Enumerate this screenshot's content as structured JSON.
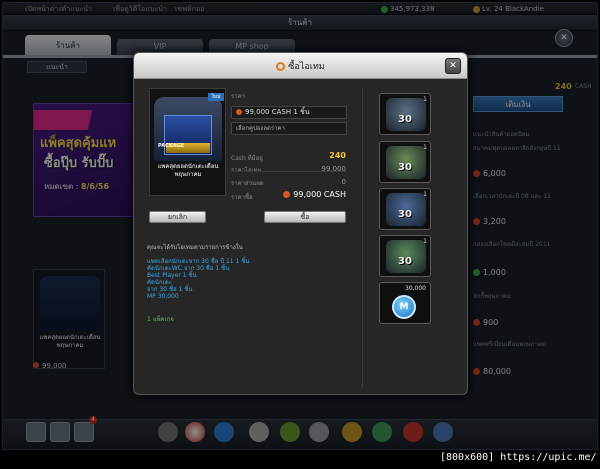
{
  "top_status": {
    "left_text": "เปิดหน้าต่างคำแนะนำ",
    "mid_text": "เพื่อดูวิดีโอแนะนำ",
    "right_text": "เซฟคิกออ",
    "gp_amount": "345,973,338",
    "level_text": "Lv. 24 BlackAndie"
  },
  "header": {
    "shop_title": "ร้านค้า",
    "close_glyph": "✕"
  },
  "tabs": [
    {
      "label": "ร้านค้า"
    },
    {
      "label": "VIP"
    },
    {
      "label": "MP shop"
    }
  ],
  "subtab": {
    "label": "แนะนำ"
  },
  "promo": {
    "line1": "แพ็คสุดคุ้มแห",
    "line2": "ซื้อปุ๊บ รับปั๊บ",
    "date_label": "หมดเขต :",
    "date_value": "8/6/56"
  },
  "bg_card": {
    "name": "แพคสุดยอดนักเตะเดือนพฤษภาคม",
    "price": "99,000"
  },
  "sidebar": {
    "cash_amount": "240",
    "cash_label": "CASH",
    "topup_label": "เติมเงิน",
    "items": [
      {
        "label": "แนะนำสินค้ายอดนิยม",
        "price": ""
      },
      {
        "label": "สมาคมฟุตบอลคลาสิกอังกฤษปี 11",
        "price": "6,000"
      },
      {
        "label": "เลือกเวลานักเตะปี 08 และ 11",
        "price": "3,200"
      },
      {
        "label": "กล่องเลือกโชคดีสะสมปี 2011",
        "price": "1,000"
      },
      {
        "label": "ลักกี้พฤษภาคม",
        "price": "900"
      },
      {
        "label": "แพคพรีเมี่ยมเดือนพฤษภาคม",
        "price": "80,000"
      }
    ]
  },
  "dialog": {
    "title": "ซื้อไอเทม",
    "close_glyph": "✕",
    "product": {
      "new_badge": "ใหม่",
      "art_label": "PACKAGE",
      "name": "แพคสุดยอดนักเตะเดือนพฤษภาคม"
    },
    "form": {
      "price_label": "ราคา",
      "price_value": "99,000",
      "price_currency": "CASH",
      "price_qty": "1 ชิ้น",
      "coupon_placeholder": "เลือกคูปองลดราคา",
      "cash_owned_label": "Cash ที่มีอยู่",
      "cash_owned_value": "240",
      "item_price_label": "ราคาไอเทม",
      "item_price_value": "99,000",
      "discount_label": "ราคาส่วนลด",
      "discount_value": "0",
      "total_label": "ราคาซื้อ",
      "total_value": "99,000",
      "total_currency": "CASH"
    },
    "buttons": {
      "cancel": "ยกเลิก",
      "buy": "ซื้อ"
    },
    "description": {
      "title": "คุณจะได้รับไอเทมตามรายการข้างใน",
      "lines": [
        "แพคเลือกนักเตะจาก 30 ชื่อ ปี 11 1 ชิ้น",
        "คัดนักเตะWC จาก 30 ชื่อ 1 ชิ้น",
        "Best Player 1 ชิ้น",
        "คัดนักเตะ",
        "จาก 30 ชื่อ 1 ชิ้น",
        "MP 30,000"
      ],
      "footer": "1 แพ็คเกจ"
    },
    "items": [
      {
        "num": "30",
        "qty": "1"
      },
      {
        "num": "30",
        "qty": "1"
      },
      {
        "num": "30",
        "qty": "1"
      },
      {
        "num": "30",
        "qty": "1"
      },
      {
        "num": "M",
        "qty": "30,000"
      }
    ]
  },
  "bottom_bar": {
    "badge_count": "4"
  },
  "watermark": "[800x600] https://upic.me/"
}
